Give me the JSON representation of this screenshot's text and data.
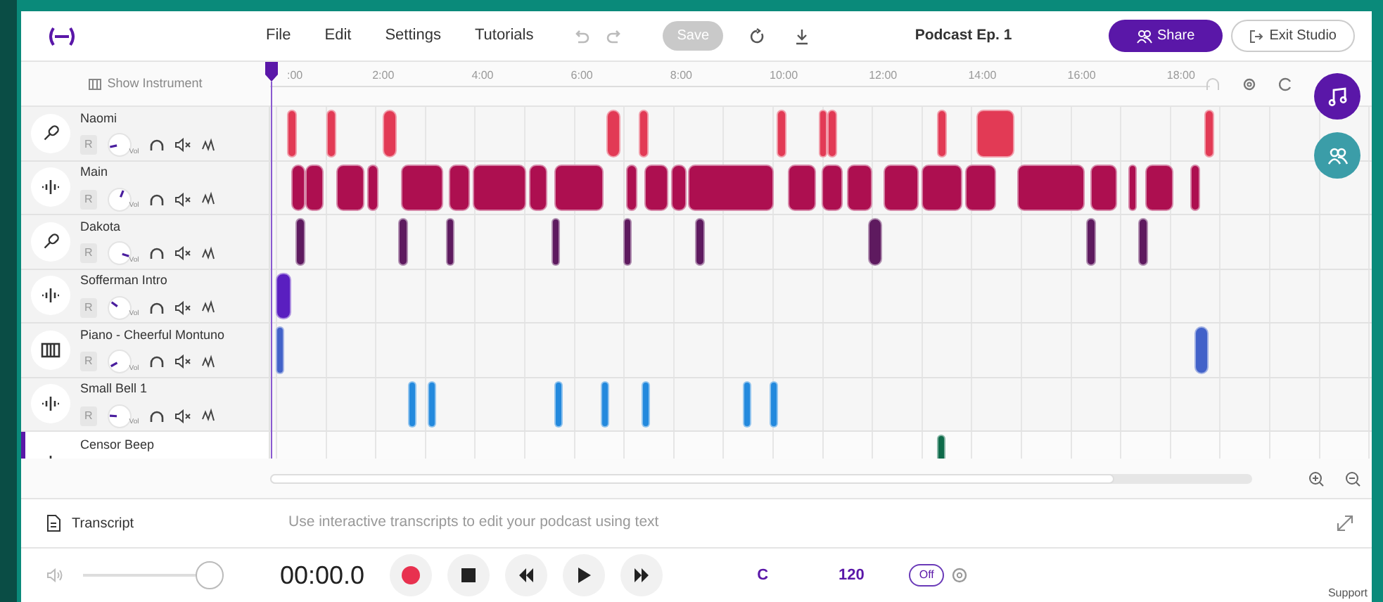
{
  "topbar": {
    "menu": [
      "File",
      "Edit",
      "Settings",
      "Tutorials"
    ],
    "save": {
      "label": "Save",
      "disabled": true
    },
    "title": "Podcast Ep. 1",
    "share": "Share",
    "exit": "Exit Studio"
  },
  "ruler": {
    "show_instrument": "Show Instrument",
    "ticks": [
      ":00",
      "2:00",
      "4:00",
      "6:00",
      "8:00",
      "10:00",
      "12:00",
      "14:00",
      "16:00",
      "18:00"
    ]
  },
  "tracks": [
    {
      "name": "Naomi",
      "kind": "mic",
      "selected": false,
      "record": "R",
      "knob_label": "Vol",
      "color": "#e23a55"
    },
    {
      "name": "Main",
      "kind": "audio",
      "selected": false,
      "record": "R",
      "knob_label": "Vol",
      "color": "#ad0f50"
    },
    {
      "name": "Dakota",
      "kind": "mic",
      "selected": false,
      "record": "R",
      "knob_label": "Vol",
      "color": "#5e1a5f"
    },
    {
      "name": "Sofferman Intro",
      "kind": "audio",
      "selected": false,
      "record": "R",
      "knob_label": "Vol",
      "color": "#5a1fc0"
    },
    {
      "name": "Piano - Cheerful Montuno",
      "kind": "instrument",
      "selected": false,
      "record": "R",
      "knob_label": "Vol",
      "color": "#4262c9"
    },
    {
      "name": "Small Bell 1",
      "kind": "audio",
      "selected": false,
      "record": "R",
      "knob_label": "Vol",
      "color": "#2389dd"
    },
    {
      "name": "Censor Beep",
      "kind": "audio",
      "selected": true,
      "color": "#0e6b4a"
    }
  ],
  "transcript": {
    "label": "Transcript",
    "hint": "Use interactive transcripts to edit your podcast using text"
  },
  "transport": {
    "volume": {
      "level": 1
    },
    "time": "00:00.0",
    "key": "C",
    "tempo": "120",
    "metronome": {
      "label": "Off",
      "on": false
    }
  },
  "support": "Support"
}
